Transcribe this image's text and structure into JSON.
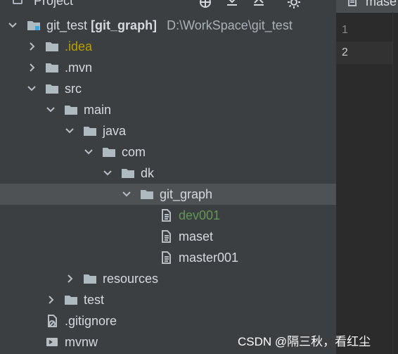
{
  "project_panel": {
    "title": "Project"
  },
  "editor": {
    "tab_label": "mase",
    "line_numbers": [
      "1",
      "2"
    ]
  },
  "tree": [
    {
      "label_prefix": "git_test",
      "label_bold": "[git_graph]",
      "path": "D:\\WorkSpace\\git_test",
      "icon": "module-folder-icon",
      "arrow": "chevron-down-icon"
    },
    {
      "label": ".idea",
      "icon": "folder-icon",
      "arrow": "chevron-right-icon"
    },
    {
      "label": ".mvn",
      "icon": "folder-icon",
      "arrow": "chevron-right-icon"
    },
    {
      "label": "src",
      "icon": "folder-icon",
      "arrow": "chevron-down-icon"
    },
    {
      "label": "main",
      "icon": "folder-icon",
      "arrow": "chevron-down-icon"
    },
    {
      "label": "java",
      "icon": "folder-icon",
      "arrow": "chevron-down-icon"
    },
    {
      "label": "com",
      "icon": "folder-icon",
      "arrow": "chevron-down-icon"
    },
    {
      "label": "dk",
      "icon": "folder-icon",
      "arrow": "chevron-down-icon"
    },
    {
      "label": "git_graph",
      "icon": "folder-icon",
      "arrow": "chevron-down-icon"
    },
    {
      "label": "dev001",
      "icon": "file-icon"
    },
    {
      "label": "maset",
      "icon": "file-icon"
    },
    {
      "label": "master001",
      "icon": "file-icon"
    },
    {
      "label": "resources",
      "icon": "folder-icon",
      "arrow": "chevron-right-icon"
    },
    {
      "label": "test",
      "icon": "folder-icon",
      "arrow": "chevron-right-icon"
    },
    {
      "label": ".gitignore",
      "icon": "gitignore-file-icon"
    },
    {
      "label": "mvnw",
      "icon": "terminal-file-icon"
    }
  ],
  "watermark": "CSDN @隔三秋，看红尘",
  "colors": {
    "panel_bg": "#3c3f41",
    "editor_bg": "#2b2b2b",
    "selected_row": "#4f5255",
    "idea_label": "#b8a000",
    "green_label": "#629755",
    "folder": "#aeb9c0",
    "file": "#b7bec4"
  }
}
